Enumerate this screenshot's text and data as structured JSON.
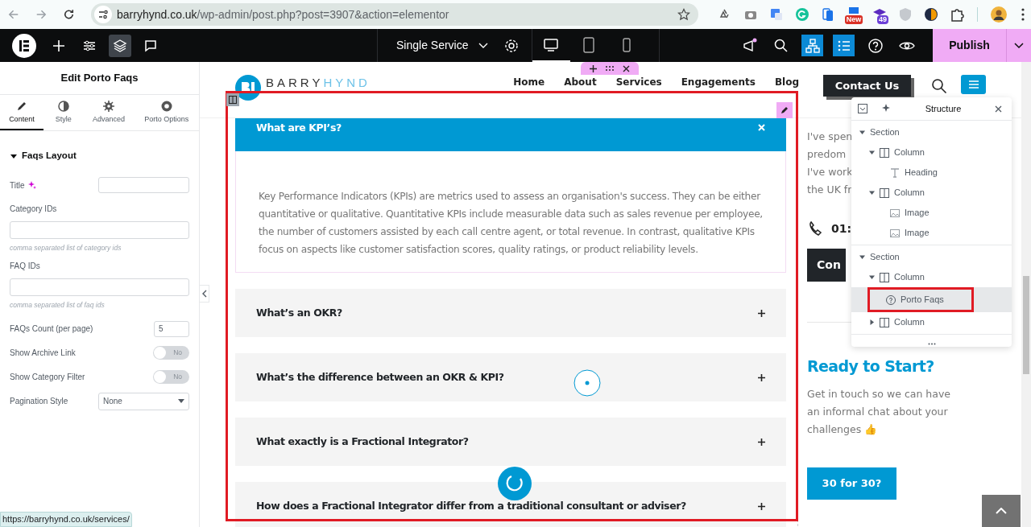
{
  "browser": {
    "url_domain": "barryhynd.co.uk",
    "url_path": "/wp-admin/post.php?post=3907&action=elementor",
    "extensions": [
      {
        "kind": "recycle"
      },
      {
        "kind": "camera"
      },
      {
        "kind": "translate"
      },
      {
        "kind": "grammar"
      },
      {
        "kind": "phone"
      },
      {
        "kind": "news",
        "badge": "New"
      },
      {
        "kind": "cap",
        "badge": "49"
      },
      {
        "kind": "shield"
      },
      {
        "kind": "swirl"
      },
      {
        "kind": "puzzle"
      }
    ]
  },
  "editor_bar": {
    "tools": [
      {
        "kind": "add",
        "selected": false
      },
      {
        "kind": "settings",
        "selected": false
      },
      {
        "kind": "layers",
        "selected": true
      },
      {
        "kind": "comment",
        "selected": false
      }
    ],
    "page_title": "Single Service",
    "devices": [
      {
        "kind": "desktop",
        "selected": true
      },
      {
        "kind": "tablet",
        "selected": false
      },
      {
        "kind": "mobile",
        "selected": false
      }
    ],
    "actions": [
      {
        "kind": "notify",
        "active": false
      },
      {
        "kind": "search",
        "active": false
      },
      {
        "kind": "structure",
        "active": true
      },
      {
        "kind": "navigator",
        "active": true
      },
      {
        "kind": "help",
        "active": false
      },
      {
        "kind": "preview",
        "active": false
      }
    ],
    "publish": "Publish"
  },
  "panel": {
    "title": "Edit Porto Faqs",
    "tabs": [
      {
        "label": "Content",
        "kind": "pencil",
        "selected": true
      },
      {
        "label": "Style",
        "kind": "contrast",
        "selected": false
      },
      {
        "label": "Advanced",
        "kind": "gear",
        "selected": false
      },
      {
        "label": "Porto Options",
        "kind": "ring",
        "selected": false
      }
    ],
    "section": {
      "label": "Faqs Layout",
      "expanded": true
    },
    "fields": [
      {
        "kind": "text",
        "label": "Title",
        "ai": true
      },
      {
        "kind": "wide",
        "label": "Category IDs",
        "hint": "comma separated list of category ids"
      },
      {
        "kind": "wide",
        "label": "FAQ IDs",
        "hint": "comma separated list of faq ids"
      },
      {
        "kind": "number",
        "label": "FAQs Count (per page)",
        "value": "5"
      },
      {
        "kind": "toggle",
        "label": "Show Archive Link",
        "on": false,
        "state_text": "No"
      },
      {
        "kind": "toggle",
        "label": "Show Category Filter",
        "on": false,
        "state_text": "No"
      },
      {
        "kind": "select",
        "label": "Pagination Style",
        "value": "None"
      }
    ]
  },
  "site": {
    "logo": {
      "first": "BARRY",
      "second": "HYND"
    },
    "nav": [
      "Home",
      "About",
      "Services",
      "Engagements",
      "Blog"
    ],
    "contact": "Contact Us",
    "faqs": [
      {
        "question": "What are KPI’s?",
        "expanded": true,
        "answer": "Key Performance Indicators (KPIs) are metrics used to assess an organisation's success. They can be either quantitative or qualitative. Quantitative KPIs include measurable data such as sales revenue per employee, the number of customers assisted by each call centre agent, or total revenue. In contrast, qualitative KPIs focus on aspects like customer satisfaction scores, quality ratings, or product reliability levels."
      },
      {
        "question": "What’s an OKR?",
        "expanded": false
      },
      {
        "question": "What’s the difference between an OKR & KPI?",
        "expanded": false
      },
      {
        "question": "What exactly is a Fractional Integrator?",
        "expanded": false
      },
      {
        "question": "How does a Fractional Integrator differ from a traditional consultant or adviser?",
        "expanded": false
      }
    ],
    "side_lines": [
      "I've spen",
      "predom",
      "I've work",
      "the UK fr"
    ],
    "phone": "01:",
    "side_button": "Con",
    "cta": {
      "title": "Ready to Start?",
      "text": "Get in touch so we can have an informal chat about your challenges 👍",
      "button": "30 for 30?"
    }
  },
  "structure": {
    "title": "Structure",
    "tree": [
      {
        "label": "Section",
        "kind": "section",
        "expanded": true,
        "selected": false,
        "children": [
          {
            "label": "Column",
            "kind": "column",
            "expanded": true,
            "selected": false,
            "children": [
              {
                "label": "Heading",
                "kind": "heading",
                "selected": false
              }
            ]
          },
          {
            "label": "Column",
            "kind": "column",
            "expanded": true,
            "selected": false,
            "children": [
              {
                "label": "Image",
                "kind": "image",
                "selected": false
              },
              {
                "label": "Image",
                "kind": "image",
                "selected": false
              }
            ]
          }
        ]
      },
      {
        "label": "Section",
        "kind": "section",
        "expanded": true,
        "selected": false,
        "children": [
          {
            "label": "Column",
            "kind": "column",
            "expanded": true,
            "selected": false,
            "children": [
              {
                "label": "Porto Faqs",
                "kind": "faq",
                "selected": true
              }
            ]
          },
          {
            "label": "Column",
            "kind": "column",
            "expanded": false,
            "selected": false
          }
        ]
      }
    ]
  },
  "status_url": "https://barryhynd.co.uk/services/"
}
